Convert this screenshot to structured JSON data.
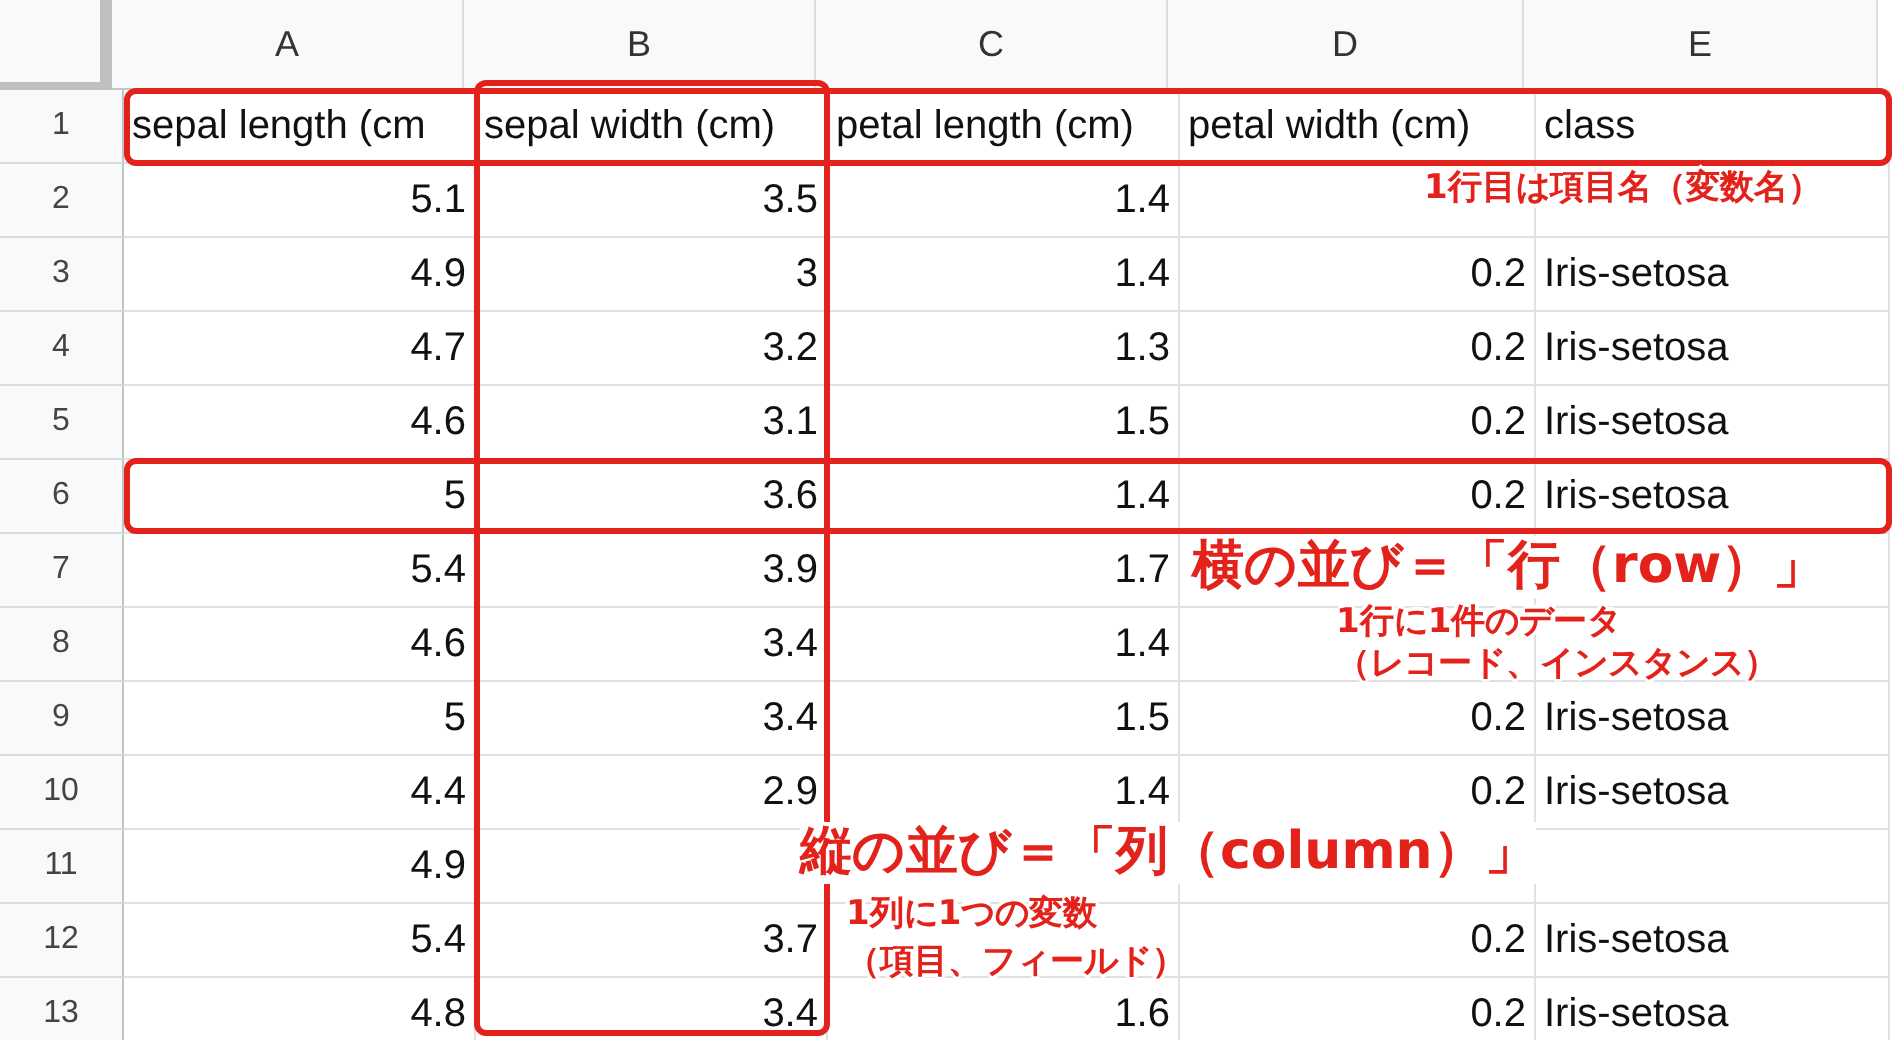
{
  "column_headers": [
    "A",
    "B",
    "C",
    "D",
    "E"
  ],
  "rows": [
    {
      "number": "1",
      "kind": "header",
      "cells": [
        "sepal length (cm",
        "sepal width (cm)",
        "petal length (cm)",
        "petal width (cm)",
        "class"
      ]
    },
    {
      "number": "2",
      "kind": "data",
      "cells": [
        "5.1",
        "3.5",
        "1.4",
        null,
        null
      ]
    },
    {
      "number": "3",
      "kind": "data",
      "cells": [
        "4.9",
        "3",
        "1.4",
        "0.2",
        "Iris-setosa"
      ]
    },
    {
      "number": "4",
      "kind": "data",
      "cells": [
        "4.7",
        "3.2",
        "1.3",
        "0.2",
        "Iris-setosa"
      ]
    },
    {
      "number": "5",
      "kind": "data",
      "cells": [
        "4.6",
        "3.1",
        "1.5",
        "0.2",
        "Iris-setosa"
      ]
    },
    {
      "number": "6",
      "kind": "data",
      "cells": [
        "5",
        "3.6",
        "1.4",
        "0.2",
        "Iris-setosa"
      ]
    },
    {
      "number": "7",
      "kind": "data",
      "cells": [
        "5.4",
        "3.9",
        "1.7",
        null,
        null
      ]
    },
    {
      "number": "8",
      "kind": "data",
      "cells": [
        "4.6",
        "3.4",
        "1.4",
        null,
        null
      ]
    },
    {
      "number": "9",
      "kind": "data",
      "cells": [
        "5",
        "3.4",
        "1.5",
        "0.2",
        "Iris-setosa"
      ]
    },
    {
      "number": "10",
      "kind": "data",
      "cells": [
        "4.4",
        "2.9",
        "1.4",
        "0.2",
        "Iris-setosa"
      ]
    },
    {
      "number": "11",
      "kind": "data",
      "cells": [
        "4.9",
        null,
        null,
        null,
        null
      ]
    },
    {
      "number": "12",
      "kind": "data",
      "cells": [
        "5.4",
        "3.7",
        null,
        "0.2",
        "Iris-setosa"
      ]
    },
    {
      "number": "13",
      "kind": "data",
      "cells": [
        "4.8",
        "3.4",
        "1.6",
        "0.2",
        "Iris-setosa"
      ]
    }
  ],
  "notes": [
    {
      "kind": "small",
      "text": "1行目は項目名（変数名）"
    },
    {
      "kind": "large",
      "text": "横の並び＝「行（row）」"
    },
    {
      "kind": "small",
      "text": "1行に1件のデータ"
    },
    {
      "kind": "small",
      "text": "（レコード、インスタンス）"
    },
    {
      "kind": "large",
      "text": "縦の並び＝「列（column）」"
    },
    {
      "kind": "small",
      "text": "1列に1つの変数"
    },
    {
      "kind": "small",
      "text": "（項目、フィールド）"
    }
  ]
}
